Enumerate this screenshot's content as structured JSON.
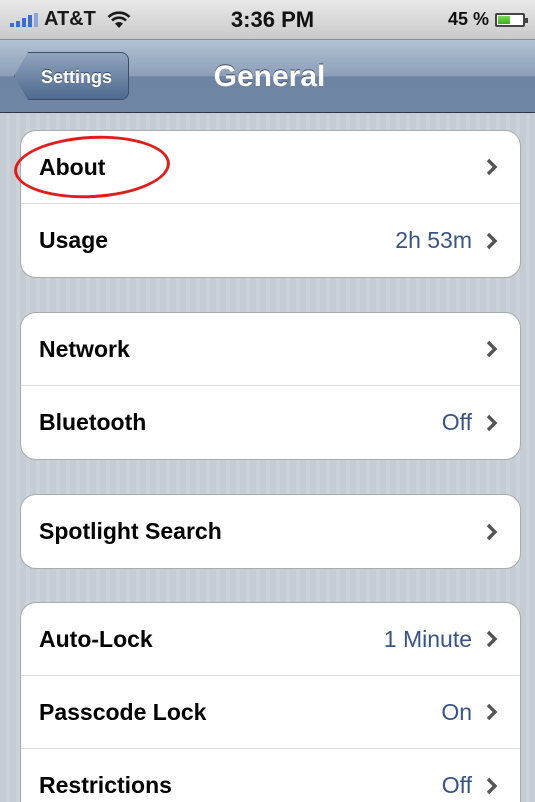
{
  "status_bar": {
    "carrier": "AT&T",
    "time": "3:36 PM",
    "battery": "45 %",
    "battery_level": 0.45
  },
  "nav": {
    "back_label": "Settings",
    "title": "General"
  },
  "groups": [
    {
      "rows": [
        {
          "label": "About",
          "value": ""
        },
        {
          "label": "Usage",
          "value": "2h 53m"
        }
      ]
    },
    {
      "rows": [
        {
          "label": "Network",
          "value": ""
        },
        {
          "label": "Bluetooth",
          "value": "Off"
        }
      ]
    },
    {
      "rows": [
        {
          "label": "Spotlight Search",
          "value": ""
        }
      ]
    },
    {
      "rows": [
        {
          "label": "Auto-Lock",
          "value": "1 Minute"
        },
        {
          "label": "Passcode Lock",
          "value": "On"
        },
        {
          "label": "Restrictions",
          "value": "Off"
        }
      ]
    }
  ],
  "annotation": {
    "circle_color": "#e01d1d",
    "target": "About"
  },
  "colors": {
    "value_text": "#385487",
    "nav_bar": "#6d84a2",
    "background": "#c5ccd4"
  }
}
